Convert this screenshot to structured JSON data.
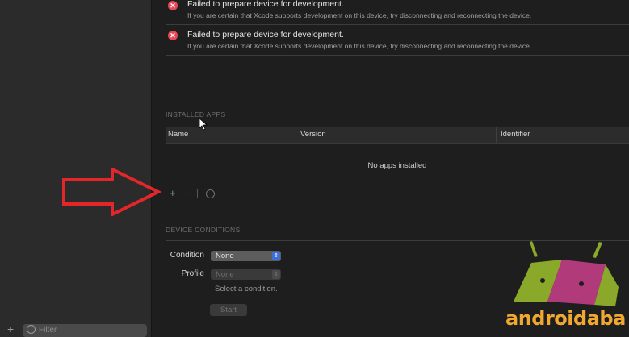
{
  "sidebar": {
    "filter_placeholder": "Filter",
    "add_glyph": "+"
  },
  "errors": [
    {
      "title": "Failed to prepare device for development.",
      "detail": "If you are certain that Xcode supports development on this device, try disconnecting and reconnecting the device."
    },
    {
      "title": "Failed to prepare device for development.",
      "detail": "If you are certain that Xcode supports development on this device, try disconnecting and reconnecting the device."
    }
  ],
  "installed_apps": {
    "section_title": "INSTALLED APPS",
    "columns": [
      "Name",
      "Version",
      "Identifier"
    ],
    "empty_message": "No apps installed",
    "toolbar": {
      "add": "+",
      "remove": "−"
    }
  },
  "device_conditions": {
    "section_title": "DEVICE CONDITIONS",
    "condition_label": "Condition",
    "condition_value": "None",
    "profile_label": "Profile",
    "profile_value": "None",
    "hint": "Select a condition.",
    "start_label": "Start"
  },
  "watermark": {
    "text": "androidaba"
  },
  "colors": {
    "error_red": "#e84755",
    "popup_accent": "#3d6fd6",
    "annotation_arrow": "#e2262a",
    "wordmark": "#f0a830"
  }
}
